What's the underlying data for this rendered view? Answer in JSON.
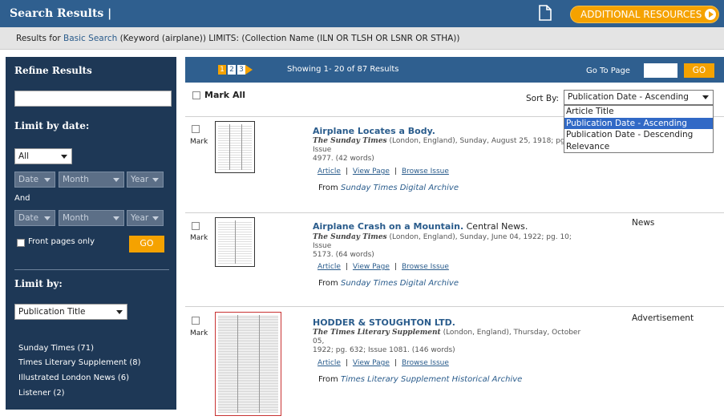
{
  "header": {
    "title": "Search Results |",
    "additional_resources": "ADDITIONAL RESOURCES"
  },
  "results_for": {
    "prefix": "Results for ",
    "search_type": "Basic Search",
    "query": " (Keyword (airplane)) LIMITS: (Collection Name (ILN OR TLSH OR LSNR OR STHA))"
  },
  "sidebar": {
    "refine_title": "Refine Results",
    "search_value": "",
    "limit_by_date_title": "Limit by date:",
    "date_range": "All",
    "from": {
      "date": "Date",
      "month": "Month",
      "year": "Year"
    },
    "and_label": "And",
    "to": {
      "date": "Date",
      "month": "Month",
      "year": "Year"
    },
    "front_pages_label": "Front pages only",
    "go_label": "GO",
    "limit_by_title": "Limit by:",
    "limit_by_select": "Publication Title",
    "facets": [
      "Sunday Times (71)",
      "Times Literary Supplement (8)",
      "Illustrated London News (6)",
      "Listener (2)"
    ]
  },
  "nav": {
    "pages": [
      "1",
      "2",
      "3"
    ],
    "current_page": "1",
    "showing": "Showing 1- 20 of 87 Results",
    "go_to_page_label": "Go To Page",
    "go_to_page_value": "",
    "go_label": "GO"
  },
  "mark_all_label": "Mark All",
  "sort": {
    "label": "Sort By:",
    "selected": "Publication Date - Ascending",
    "options": [
      "Article Title",
      "Publication Date - Ascending",
      "Publication Date - Descending",
      "Relevance"
    ]
  },
  "results": [
    {
      "mark_label": "Mark",
      "title": "Airplane Locates a Body.",
      "subtitle": "",
      "publication": "The Sunday Times",
      "citation_line1": " (London, England), Sunday, August 25, 1918; pg. 7; Issue",
      "citation_line2": "4977.  (42 words)",
      "type": "",
      "links": {
        "article": "Article",
        "view_page": "View Page",
        "browse_issue": "Browse Issue"
      },
      "from_label": "From ",
      "archive": "Sunday Times Digital Archive"
    },
    {
      "mark_label": "Mark",
      "title": "Airplane Crash on a Mountain.",
      "subtitle": " Central News.",
      "publication": "The Sunday Times",
      "citation_line1": " (London, England), Sunday, June 04, 1922; pg. 10; Issue",
      "citation_line2": "5173.  (64 words)",
      "type": "News",
      "links": {
        "article": "Article",
        "view_page": "View Page",
        "browse_issue": "Browse Issue"
      },
      "from_label": "From ",
      "archive": "Sunday Times Digital Archive"
    },
    {
      "mark_label": "Mark",
      "title": "HODDER & STOUGHTON LTD.",
      "subtitle": "",
      "publication": "The Times Literary Supplement",
      "citation_line1": " (London, England), Thursday, October 05,",
      "citation_line2": "1922; pg. 632; Issue 1081.  (146 words)",
      "type": "Advertisement",
      "links": {
        "article": "Article",
        "view_page": "View Page",
        "browse_issue": "Browse Issue"
      },
      "from_label": "From ",
      "archive": "Times Literary Supplement Historical Archive"
    }
  ]
}
